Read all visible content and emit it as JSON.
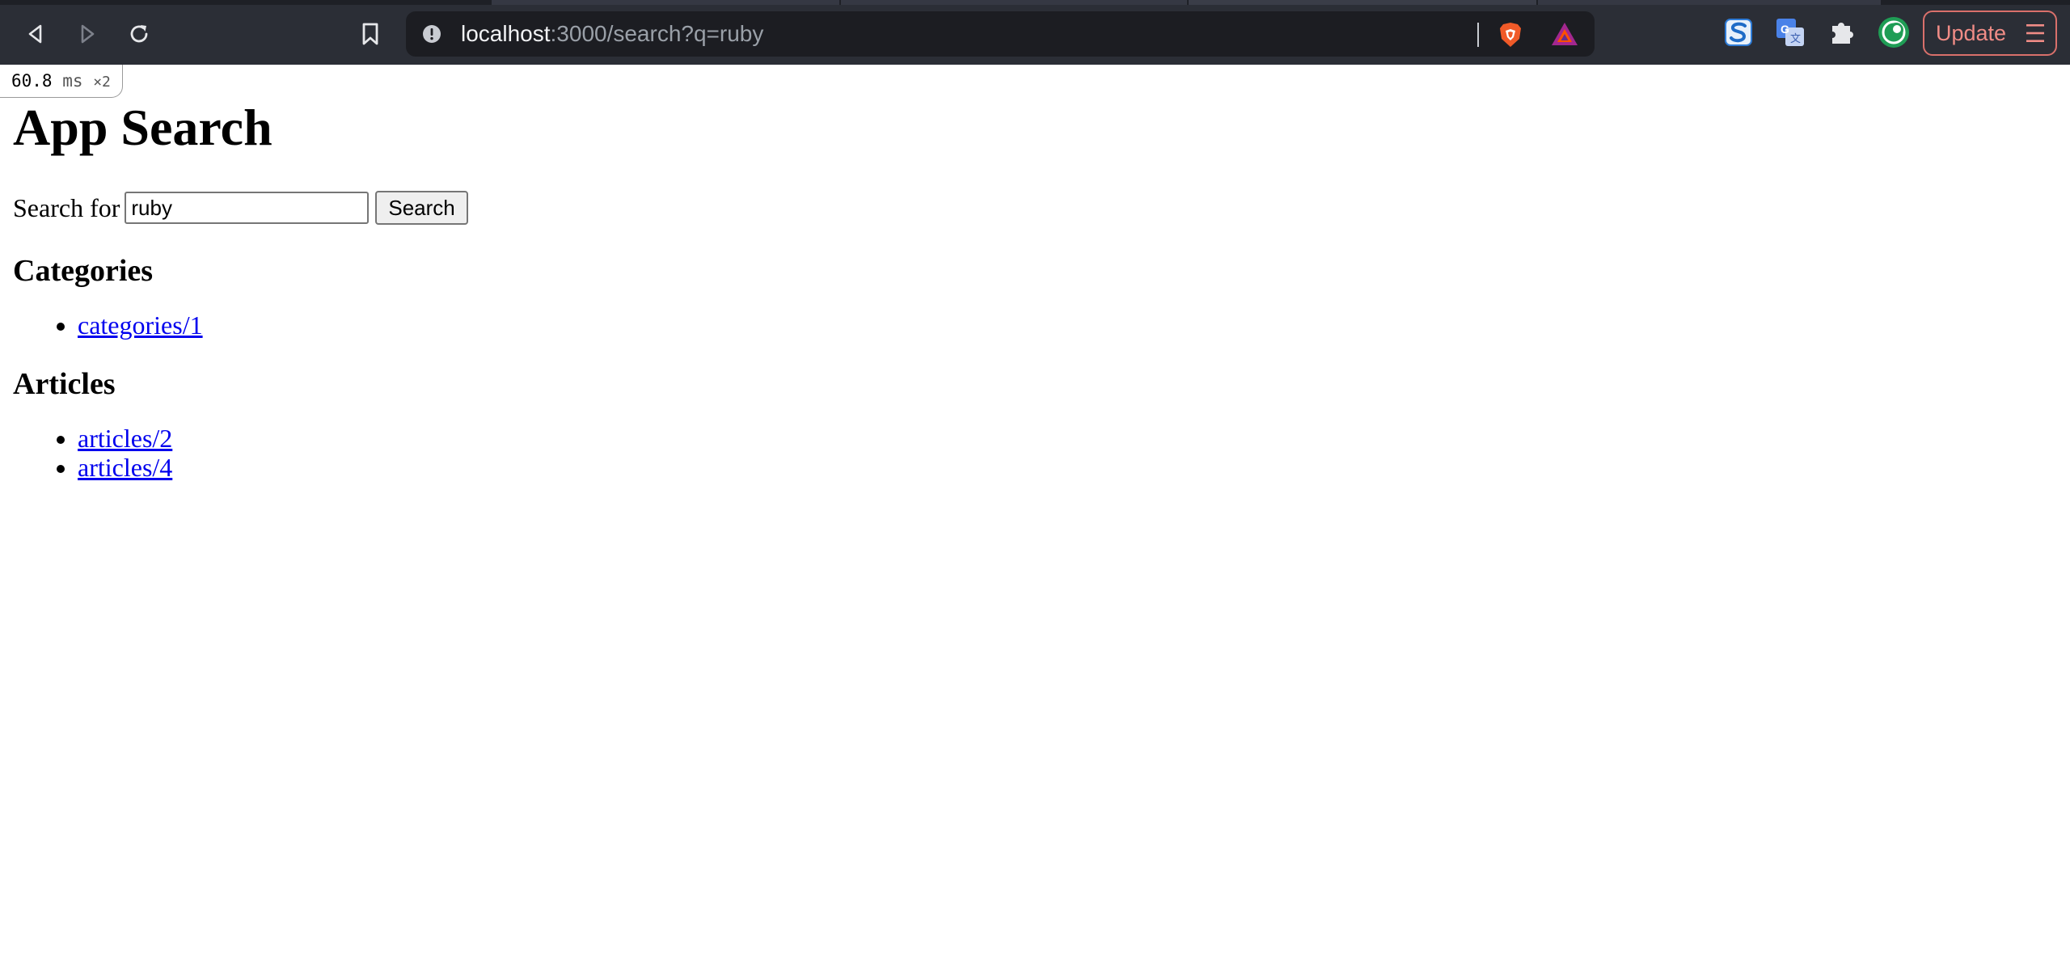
{
  "browser": {
    "url_host": "localhost",
    "url_rest": ":3000/search?q=ruby",
    "update_label": "Update",
    "icons": {
      "back": "back-arrow-icon",
      "forward": "forward-arrow-icon",
      "reload": "reload-icon",
      "bookmark": "bookmark-icon",
      "site_info": "site-info-icon",
      "brave_shields": "brave-shields-icon",
      "brave_rewards": "brave-rewards-icon",
      "extensions": [
        "s-extension-icon",
        "translate-extension-icon",
        "puzzle-extensions-icon",
        "profile-avatar-icon"
      ],
      "menu": "hamburger-menu-icon"
    },
    "colors": {
      "chrome_bg": "#2b2e36",
      "omnibox_bg": "#1c1d22",
      "update_accent": "#f08c86"
    }
  },
  "profiler": {
    "time": "60.8",
    "unit": "ms",
    "count": "×2"
  },
  "page": {
    "title": "App Search",
    "search": {
      "label": "Search for",
      "value": "ruby",
      "button_label": "Search"
    },
    "categories": {
      "heading": "Categories",
      "items": [
        "categories/1"
      ]
    },
    "articles": {
      "heading": "Articles",
      "items": [
        "articles/2",
        "articles/4"
      ]
    },
    "colors": {
      "link": "#0000ee"
    }
  }
}
